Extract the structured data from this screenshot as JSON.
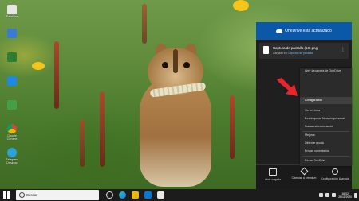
{
  "desktop": {
    "icons": [
      {
        "label": "Papelera",
        "icon": "recycle-bin-icon"
      },
      {
        "label": "",
        "icon": "app-icon"
      },
      {
        "label": "",
        "icon": "app-icon"
      },
      {
        "label": "",
        "icon": "app-icon"
      },
      {
        "label": "",
        "icon": "app-icon"
      },
      {
        "label": "Google Chrome",
        "icon": "chrome-icon"
      },
      {
        "label": "Telegram Desktop",
        "icon": "telegram-icon"
      }
    ]
  },
  "onedrive": {
    "header": "OneDrive está actualizado",
    "file": {
      "name": "Captura de pantalla (13).png",
      "sub_prefix": "Cargado en ",
      "sub_link": "Capturas de pantalla"
    },
    "menu": [
      "Abrir la carpeta de OneDrive",
      "Configuración",
      "Ver en línea",
      "Desbloquear Almacén personal",
      "Pausar sincronización",
      "Mejoras",
      "Obtener ayuda",
      "Enviar comentarios",
      "Cerrar OneDrive"
    ],
    "footer": {
      "open_folder": "Abrir carpeta",
      "premium": "Cambiar a premium",
      "settings": "Configuración & ayuda"
    }
  },
  "taskbar": {
    "search_placeholder": "Buscar",
    "clock_time": "16:02",
    "clock_date": "26/11/2020"
  },
  "colors": {
    "onedrive_header": "#0b57a8",
    "arrow": "#e8252a"
  }
}
